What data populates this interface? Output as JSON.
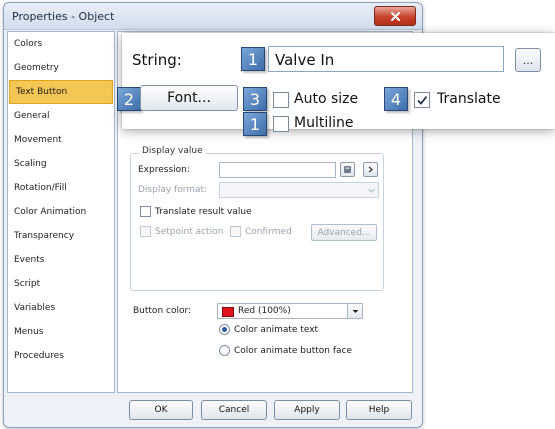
{
  "window": {
    "title": "Properties - Object"
  },
  "sidebar": {
    "items": [
      {
        "label": "Colors"
      },
      {
        "label": "Geometry"
      },
      {
        "label": "Text Button"
      },
      {
        "label": "General"
      },
      {
        "label": "Movement"
      },
      {
        "label": "Scaling"
      },
      {
        "label": "Rotation/Fill"
      },
      {
        "label": "Color Animation"
      },
      {
        "label": "Transparency"
      },
      {
        "label": "Events"
      },
      {
        "label": "Script"
      },
      {
        "label": "Variables"
      },
      {
        "label": "Menus"
      },
      {
        "label": "Procedures"
      }
    ],
    "active_index": 2
  },
  "callout": {
    "string_label": "String:",
    "string_value": "Valve In",
    "ellipsis_label": "...",
    "font_button": "Font...",
    "auto_size_label": "Auto size",
    "auto_size_checked": false,
    "translate_label": "Translate",
    "translate_checked": true,
    "multiline_label": "Multiline",
    "multiline_checked": false,
    "badges": {
      "string": "1",
      "font": "2",
      "auto_size": "3",
      "translate": "4",
      "multiline": "1"
    }
  },
  "display_value": {
    "legend": "Display value",
    "expression_label": "Expression:",
    "expression_value": "",
    "display_format_label": "Display format:",
    "display_format_value": "",
    "translate_result_label": "Translate result value",
    "setpoint_label": "Setpoint action",
    "confirmed_label": "Confirmed",
    "advanced_button": "Advanced..."
  },
  "button_color": {
    "label": "Button color:",
    "value": "Red (100%)",
    "swatch_color": "#e0141a",
    "radio_text": "Color animate text",
    "radio_face": "Color animate button face",
    "selected": "text"
  },
  "footer": {
    "ok": "OK",
    "cancel": "Cancel",
    "apply": "Apply",
    "help": "Help"
  },
  "colors": {
    "active_nav": "#f4c654",
    "badge": "#4f7fbe",
    "close_button": "#c8422e"
  }
}
